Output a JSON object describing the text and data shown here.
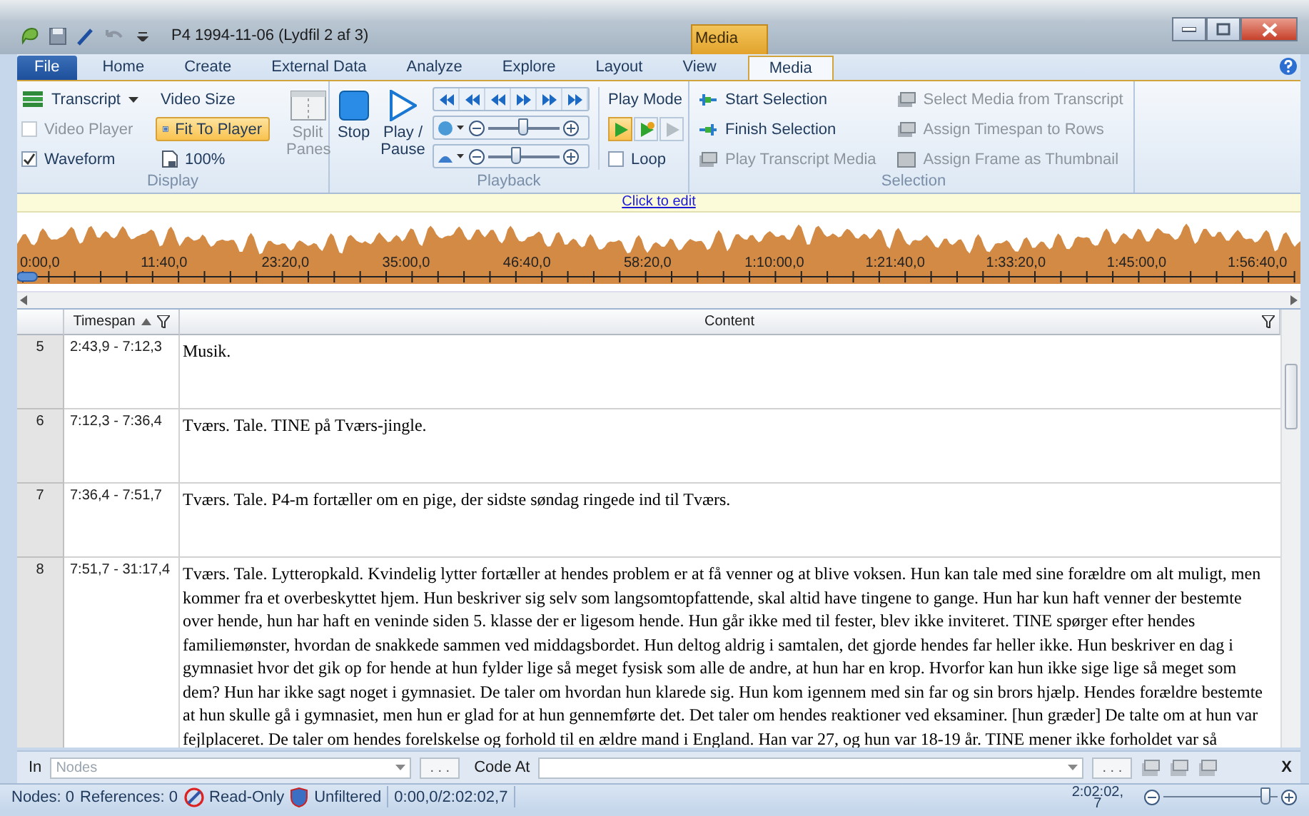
{
  "window": {
    "title": "P4 1994-11-06 (Lydfil 2 af 3)",
    "context_tab": "Media"
  },
  "tabs": [
    {
      "label": "File",
      "kind": "file",
      "selected": false
    },
    {
      "label": "Home",
      "kind": "tab",
      "selected": false
    },
    {
      "label": "Create",
      "kind": "tab",
      "selected": false
    },
    {
      "label": "External Data",
      "kind": "tab",
      "selected": false
    },
    {
      "label": "Analyze",
      "kind": "tab",
      "selected": false
    },
    {
      "label": "Explore",
      "kind": "tab",
      "selected": false
    },
    {
      "label": "Layout",
      "kind": "tab",
      "selected": false
    },
    {
      "label": "View",
      "kind": "tab",
      "selected": false
    },
    {
      "label": "Media",
      "kind": "tab",
      "selected": true
    }
  ],
  "display": {
    "label": "Display",
    "transcript": "Transcript",
    "video_player": {
      "label": "Video Player",
      "checked": false,
      "disabled": true
    },
    "waveform": {
      "label": "Waveform",
      "checked": true,
      "disabled": false
    },
    "video_size": "Video Size",
    "fit_to_player": {
      "label": "Fit To Player",
      "selected": true
    },
    "zoom_100": {
      "label": "100%",
      "selected": false
    },
    "split_panes": {
      "label": "Split Panes",
      "disabled": true
    }
  },
  "playback": {
    "label": "Playback",
    "stop": "Stop",
    "play_pause": "Play / Pause",
    "volume": {
      "level": 0.5
    },
    "speed": {
      "level": 0.4
    }
  },
  "play_mode": {
    "label": "Play Mode",
    "modes": [
      {
        "selected": true
      },
      {
        "selected": false
      },
      {
        "selected": false
      }
    ],
    "loop": {
      "label": "Loop",
      "checked": false
    }
  },
  "selection": {
    "label": "Selection",
    "items": [
      {
        "label": "Start Selection",
        "disabled": false
      },
      {
        "label": "Finish Selection",
        "disabled": false
      },
      {
        "label": "Play Transcript Media",
        "disabled": true
      },
      {
        "label": "Select Media from Transcript",
        "disabled": true
      },
      {
        "label": "Assign Timespan to Rows",
        "disabled": true
      },
      {
        "label": "Assign Frame as Thumbnail",
        "disabled": true
      }
    ]
  },
  "edit_link": "Click to edit",
  "waveform": {
    "ticks": [
      "0:00,0",
      "11:40,0",
      "23:20,0",
      "35:00,0",
      "46:40,0",
      "58:20,0",
      "1:10:00,0",
      "1:21:40,0",
      "1:33:20,0",
      "1:45:00,0",
      "1:56:40,0"
    ]
  },
  "table": {
    "columns": [
      {
        "label": "Timespan"
      },
      {
        "label": "Content"
      }
    ],
    "rows": [
      {
        "number": "5",
        "timespan": "2:43,9 - 7:12,3",
        "content": "Musik."
      },
      {
        "number": "6",
        "timespan": "7:12,3 - 7:36,4",
        "content": "Tværs. Tale. TINE på Tværs-jingle."
      },
      {
        "number": "7",
        "timespan": "7:36,4 - 7:51,7",
        "content": "Tværs. Tale. P4-m fortæller om en pige, der sidste søndag ringede ind til Tværs."
      },
      {
        "number": "8",
        "timespan": "7:51,7 - 31:17,4",
        "content": "Tværs. Tale. Lytteropkald. Kvindelig lytter fortæller at hendes problem er at få venner og at blive voksen. Hun kan tale med sine forældre om alt muligt, men kommer fra et overbeskyttet hjem. Hun beskriver sig selv som langsomtopfattende, skal altid have tingene to gange. Hun har kun haft venner der bestemte over hende, hun har haft en veninde siden 5. klasse der er ligesom hende. Hun går ikke med til fester, blev ikke inviteret. TINE spørger efter hendes familiemønster, hvordan de snakkede sammen ved middagsbordet. Hun deltog aldrig i samtalen, det gjorde hendes far heller ikke. Hun beskriver en dag i gymnasiet hvor det gik op for hende at hun fylder lige så meget fysisk som alle de andre, at hun har en krop. Hvorfor kan hun ikke sige lige så meget som dem? Hun har ikke sagt noget i gymnasiet. De taler om hvordan hun klarede sig. Hun kom igennem med sin far og sin brors hjælp. Hendes forældre bestemte at hun skulle gå i gymnasiet, men hun er glad for at hun gennemførte det. Det taler om hendes reaktioner ved eksaminer. [hun græder] De talte om at hun var fejlplaceret. De taler om hendes forelskelse og forhold til en ældre mand i England. Han var 27, og hun var 18-19 år. TINE mener ikke forholdet var så"
      }
    ]
  },
  "coding_bar": {
    "in_label": "In",
    "nodes": {
      "placeholder": "Nodes"
    },
    "browse": ". . .",
    "code_at_label": "Code At",
    "browse_2": ". . .",
    "close": "X"
  },
  "status_bar": {
    "nodes": "Nodes: 0",
    "references": "References: 0",
    "read_only": "Read-Only",
    "unfiltered": "Unfiltered",
    "position": "0:00,0/2:02:02,7",
    "duration": [
      "2:02:02,",
      "7"
    ],
    "zoom": {
      "level": 0.9
    }
  }
}
